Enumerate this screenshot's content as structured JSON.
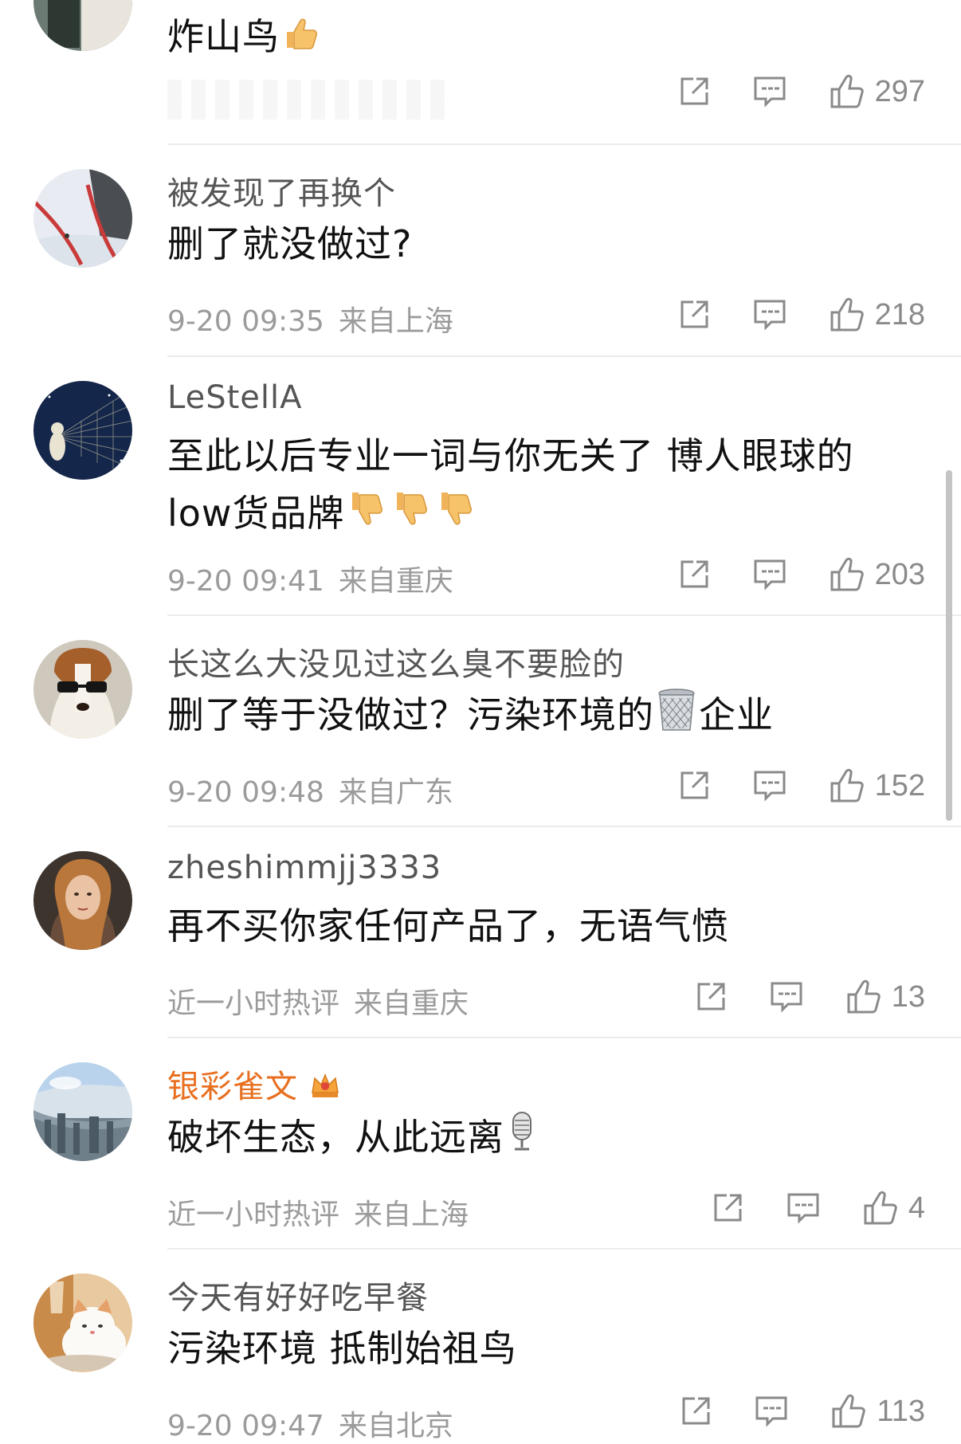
{
  "comments": [
    {
      "username": "",
      "text": "炸山鸟",
      "time": "",
      "location": "",
      "likes": "297",
      "vip": false,
      "avatar": "coffee-cup-avatar",
      "emoji": [
        "thumbs-up-emoji"
      ]
    },
    {
      "username": "被发现了再换个",
      "text": "删了就没做过?",
      "time": "9-20 09:35",
      "location": "来自上海",
      "likes": "218",
      "vip": false,
      "avatar": "ski-slope-avatar",
      "emoji": []
    },
    {
      "username": "LeStellA",
      "text": "至此以后专业一词与你无关了 博人眼球的 low货品牌",
      "time": "9-20 09:41",
      "location": "来自重庆",
      "likes": "203",
      "vip": false,
      "avatar": "starry-night-avatar",
      "emoji": [
        "thumbs-down-emoji",
        "thumbs-down-emoji",
        "thumbs-down-emoji"
      ]
    },
    {
      "username": "长这么大没见过这么臭不要脸的",
      "text": "删了等于没做过？污染环境的",
      "text_after": "企业",
      "time": "9-20 09:48",
      "location": "来自广东",
      "likes": "152",
      "vip": false,
      "avatar": "dog-sunglasses-avatar",
      "emoji": [
        "trash-can-emoji"
      ]
    },
    {
      "username": "zheshimmjj3333",
      "text": "再不买你家任何产品了，无语气愤",
      "time": "近一小时热评",
      "location": "来自重庆",
      "likes": "13",
      "vip": false,
      "avatar": "woman-portrait-avatar",
      "emoji": []
    },
    {
      "username": "银彩雀文",
      "text": "破坏生态，从此远离",
      "time": "近一小时热评",
      "location": "来自上海",
      "likes": "4",
      "vip": true,
      "avatar": "city-skyline-avatar",
      "emoji": [
        "microphone-emoji"
      ]
    },
    {
      "username": "今天有好好吃早餐",
      "text": "污染环境 抵制始祖鸟",
      "time": "9-20 09:47",
      "location": "来自北京",
      "likes": "113",
      "vip": false,
      "avatar": "cat-avatar",
      "emoji": []
    }
  ],
  "colors": {
    "vip_name": "#e86f1f",
    "meta": "#9b9b9b",
    "icon": "#8a8a8a"
  },
  "icons": {
    "repost": "repost-icon",
    "comment": "comment-icon",
    "like": "like-icon",
    "vip_badge": "vip-crown-icon"
  }
}
